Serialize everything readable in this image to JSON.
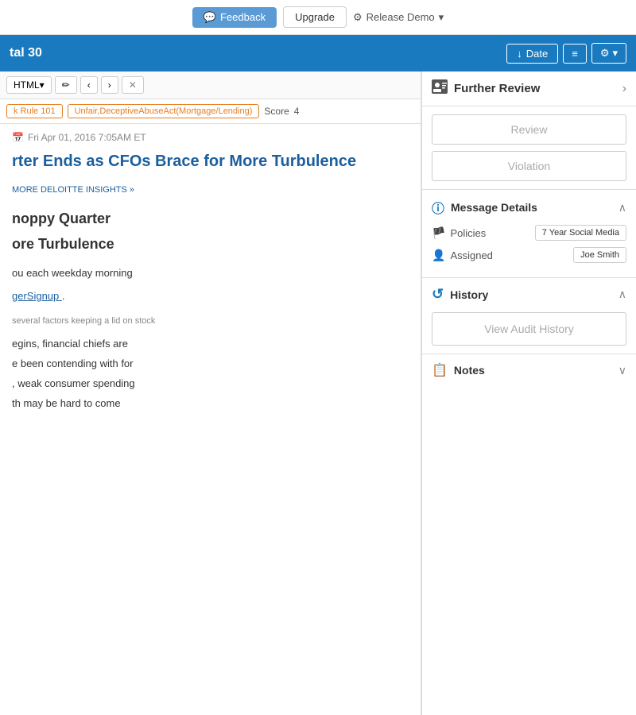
{
  "topbar": {
    "feedback_label": "Feedback",
    "upgrade_label": "Upgrade",
    "release_demo_label": "Release Demo",
    "release_demo_icon": "⚙"
  },
  "toolbar": {
    "total_label": "tal 30",
    "date_button_label": "Date",
    "date_icon": "↓",
    "lines_icon": "≡",
    "gear_icon": "⚙",
    "chevron_down": "▾"
  },
  "format_bar": {
    "html_label": "HTML",
    "dropdown_icon": "▾",
    "pencil_icon": "✏",
    "prev_icon": "‹",
    "next_icon": "›",
    "close_icon": "✕"
  },
  "tags": {
    "tag1": "k Rule 101",
    "tag2": "Unfair,DeceptiveAbuseAct(Mortgage/Lending)",
    "score_label": "Score",
    "score_value": "4"
  },
  "article": {
    "date": "Fri Apr 01, 2016 7:05AM ET",
    "calendar_icon": "📅",
    "title": "rter Ends as CFOs Brace for More Turbulence",
    "section1_label": "MORE DELOITTE INSIGHTS »",
    "section2_title1": "noppy Quarter",
    "section2_title2": "ore Turbulence",
    "body1": "ou each weekday morning",
    "link_text": "gerSignup",
    "link_suffix": ".",
    "small_text": "several factors keeping a lid on stock",
    "body2": "egins, financial chiefs are",
    "body3": "e been contending with for",
    "body4": ", weak consumer spending",
    "body5": "th may be hard to come"
  },
  "further_review": {
    "icon": "👤",
    "title": "Further Review",
    "arrow_icon": "›",
    "review_label": "Review",
    "violation_label": "Violation"
  },
  "message_details": {
    "info_icon": "ℹ",
    "title": "Message Details",
    "chevron_icon": "∧",
    "policies_icon": "🏴",
    "policies_label": "Policies",
    "policies_value": "7 Year Social Media",
    "assigned_icon": "👤",
    "assigned_label": "Assigned",
    "assigned_value": "Joe Smith"
  },
  "history": {
    "icon": "↺",
    "title": "History",
    "chevron_icon": "∧",
    "view_audit_label": "View Audit History"
  },
  "notes": {
    "icon": "📋",
    "title": "Notes",
    "chevron_icon": "∨"
  }
}
